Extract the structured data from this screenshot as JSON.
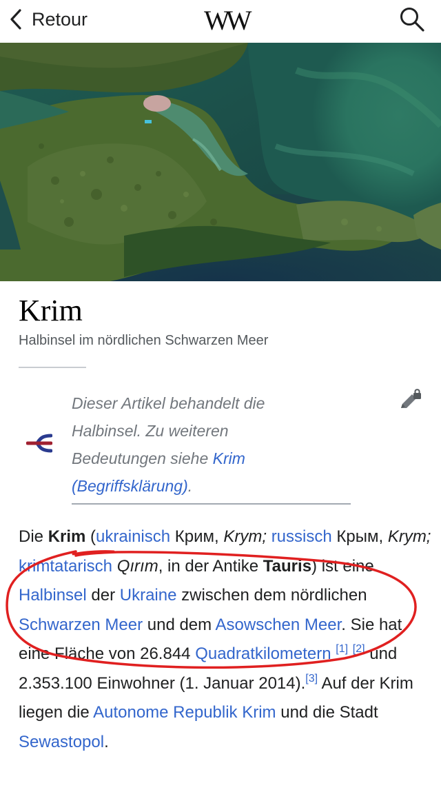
{
  "topbar": {
    "back_label": "Retour",
    "logo": "W",
    "icons": [
      "chevron-left-icon",
      "wikipedia-logo",
      "search-icon"
    ]
  },
  "hero": {
    "image": "satellite view of the Crimean peninsula"
  },
  "article": {
    "title": "Krim",
    "subtitle": "Halbinsel im nördlichen Schwarzen Meer",
    "hatnote": {
      "text_before": "Dieser Artikel behandelt die Halbinsel. Zu weiteren Bedeutungen siehe ",
      "link": "Krim (Begriffsklärung)",
      "text_after": "."
    },
    "intro": [
      {
        "t": "Die "
      },
      {
        "t": "Krim",
        "b": true
      },
      {
        "t": " ("
      },
      {
        "t": "ukrainisch",
        "link": true
      },
      {
        "t": " Крим, "
      },
      {
        "t": "Krym;",
        "i": true
      },
      {
        "t": " "
      },
      {
        "t": "russisch",
        "link": true
      },
      {
        "t": " Крым, "
      },
      {
        "t": "Krym;",
        "i": true
      },
      {
        "t": " "
      },
      {
        "t": "krimtatarisch",
        "link": true
      },
      {
        "t": " "
      },
      {
        "t": "Qırım",
        "i": true
      },
      {
        "t": ", in der Antike "
      },
      {
        "t": "Tauris",
        "b": true
      },
      {
        "t": ") ist eine "
      },
      {
        "t": "Halbinsel",
        "link": true
      },
      {
        "t": " der "
      },
      {
        "t": "Ukraine",
        "link": true
      },
      {
        "t": " zwischen dem nördlichen "
      },
      {
        "t": "Schwarzen Meer",
        "link": true
      },
      {
        "t": " und dem "
      },
      {
        "t": "Asowschen Meer",
        "link": true
      },
      {
        "t": ". Sie hat eine Fläche von 26.844 "
      },
      {
        "t": "Quadratkilometern",
        "link": true
      },
      {
        "t": " "
      },
      {
        "t": "[1]",
        "sup": true
      },
      {
        "t": " "
      },
      {
        "t": "[2]",
        "sup": true
      },
      {
        "t": " und 2.353.100 Einwohner (1. Januar 2014)."
      },
      {
        "t": "[3]",
        "sup": true
      },
      {
        "t": " Auf der Krim liegen die "
      },
      {
        "t": "Autonome Republik Krim",
        "link": true
      },
      {
        "t": " und die Stadt "
      },
      {
        "t": "Sewastopol",
        "link": true
      },
      {
        "t": "."
      }
    ]
  },
  "colors": {
    "link": "#3366cc",
    "text": "#202122",
    "muted": "#72777d",
    "annotation": "#e02020"
  }
}
